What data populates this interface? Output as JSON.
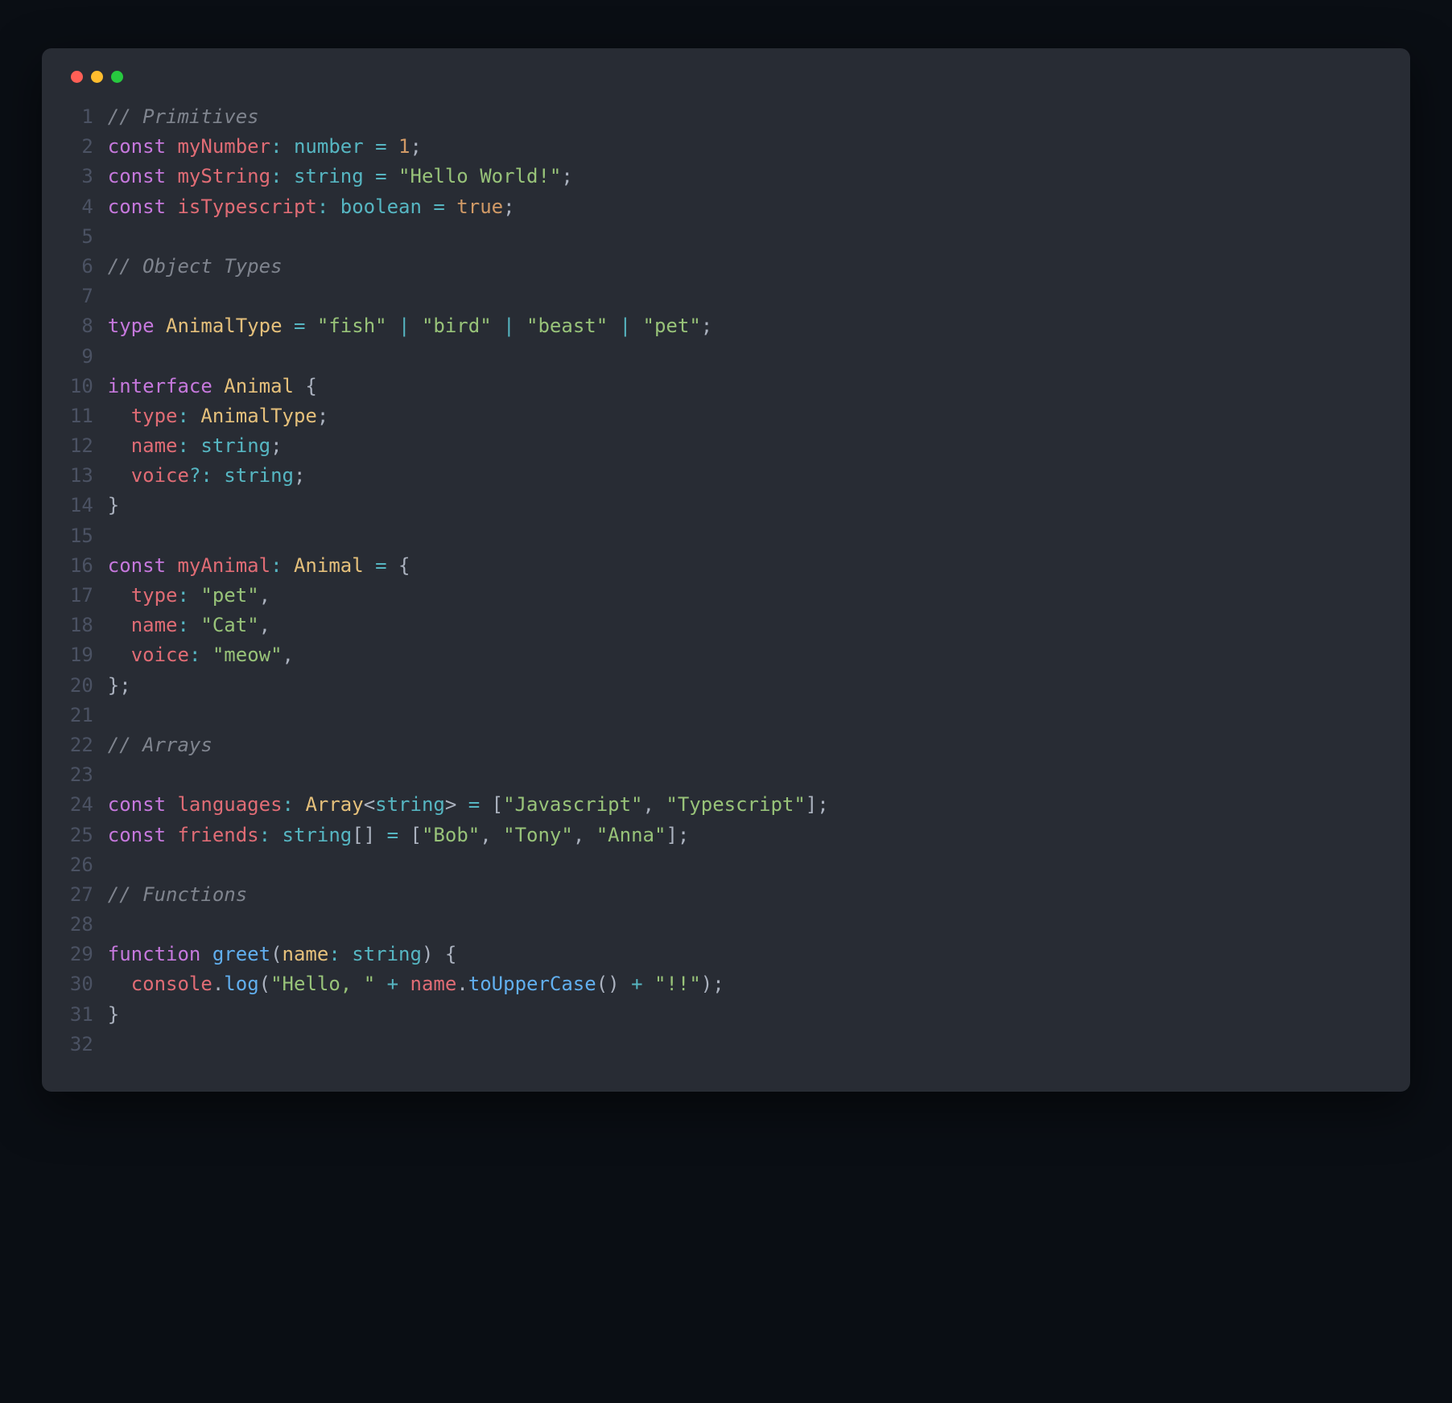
{
  "window": {
    "traffic_lights": [
      "red",
      "yellow",
      "green"
    ]
  },
  "code": {
    "lines": [
      {
        "n": 1,
        "tokens": [
          {
            "cls": "c-comment",
            "t": "// Primitives"
          }
        ]
      },
      {
        "n": 2,
        "tokens": [
          {
            "cls": "c-keyword",
            "t": "const"
          },
          {
            "cls": "c-punct",
            "t": " "
          },
          {
            "cls": "c-var",
            "t": "myNumber"
          },
          {
            "cls": "c-op",
            "t": ":"
          },
          {
            "cls": "c-punct",
            "t": " "
          },
          {
            "cls": "c-builtin",
            "t": "number"
          },
          {
            "cls": "c-punct",
            "t": " "
          },
          {
            "cls": "c-op",
            "t": "="
          },
          {
            "cls": "c-punct",
            "t": " "
          },
          {
            "cls": "c-number",
            "t": "1"
          },
          {
            "cls": "c-punct",
            "t": ";"
          }
        ]
      },
      {
        "n": 3,
        "tokens": [
          {
            "cls": "c-keyword",
            "t": "const"
          },
          {
            "cls": "c-punct",
            "t": " "
          },
          {
            "cls": "c-var",
            "t": "myString"
          },
          {
            "cls": "c-op",
            "t": ":"
          },
          {
            "cls": "c-punct",
            "t": " "
          },
          {
            "cls": "c-builtin",
            "t": "string"
          },
          {
            "cls": "c-punct",
            "t": " "
          },
          {
            "cls": "c-op",
            "t": "="
          },
          {
            "cls": "c-punct",
            "t": " "
          },
          {
            "cls": "c-string",
            "t": "\"Hello World!\""
          },
          {
            "cls": "c-punct",
            "t": ";"
          }
        ]
      },
      {
        "n": 4,
        "tokens": [
          {
            "cls": "c-keyword",
            "t": "const"
          },
          {
            "cls": "c-punct",
            "t": " "
          },
          {
            "cls": "c-var",
            "t": "isTypescript"
          },
          {
            "cls": "c-op",
            "t": ":"
          },
          {
            "cls": "c-punct",
            "t": " "
          },
          {
            "cls": "c-builtin",
            "t": "boolean"
          },
          {
            "cls": "c-punct",
            "t": " "
          },
          {
            "cls": "c-op",
            "t": "="
          },
          {
            "cls": "c-punct",
            "t": " "
          },
          {
            "cls": "c-boolean",
            "t": "true"
          },
          {
            "cls": "c-punct",
            "t": ";"
          }
        ]
      },
      {
        "n": 5,
        "tokens": []
      },
      {
        "n": 6,
        "tokens": [
          {
            "cls": "c-comment",
            "t": "// Object Types"
          }
        ]
      },
      {
        "n": 7,
        "tokens": []
      },
      {
        "n": 8,
        "tokens": [
          {
            "cls": "c-keyword",
            "t": "type"
          },
          {
            "cls": "c-punct",
            "t": " "
          },
          {
            "cls": "c-typeref",
            "t": "AnimalType"
          },
          {
            "cls": "c-punct",
            "t": " "
          },
          {
            "cls": "c-op",
            "t": "="
          },
          {
            "cls": "c-punct",
            "t": " "
          },
          {
            "cls": "c-string",
            "t": "\"fish\""
          },
          {
            "cls": "c-punct",
            "t": " "
          },
          {
            "cls": "c-op",
            "t": "|"
          },
          {
            "cls": "c-punct",
            "t": " "
          },
          {
            "cls": "c-string",
            "t": "\"bird\""
          },
          {
            "cls": "c-punct",
            "t": " "
          },
          {
            "cls": "c-op",
            "t": "|"
          },
          {
            "cls": "c-punct",
            "t": " "
          },
          {
            "cls": "c-string",
            "t": "\"beast\""
          },
          {
            "cls": "c-punct",
            "t": " "
          },
          {
            "cls": "c-op",
            "t": "|"
          },
          {
            "cls": "c-punct",
            "t": " "
          },
          {
            "cls": "c-string",
            "t": "\"pet\""
          },
          {
            "cls": "c-punct",
            "t": ";"
          }
        ]
      },
      {
        "n": 9,
        "tokens": []
      },
      {
        "n": 10,
        "tokens": [
          {
            "cls": "c-keyword",
            "t": "interface"
          },
          {
            "cls": "c-punct",
            "t": " "
          },
          {
            "cls": "c-typeref",
            "t": "Animal"
          },
          {
            "cls": "c-punct",
            "t": " {"
          }
        ]
      },
      {
        "n": 11,
        "tokens": [
          {
            "cls": "c-punct",
            "t": "  "
          },
          {
            "cls": "c-prop",
            "t": "type"
          },
          {
            "cls": "c-op",
            "t": ":"
          },
          {
            "cls": "c-punct",
            "t": " "
          },
          {
            "cls": "c-typeref",
            "t": "AnimalType"
          },
          {
            "cls": "c-punct",
            "t": ";"
          }
        ]
      },
      {
        "n": 12,
        "tokens": [
          {
            "cls": "c-punct",
            "t": "  "
          },
          {
            "cls": "c-prop",
            "t": "name"
          },
          {
            "cls": "c-op",
            "t": ":"
          },
          {
            "cls": "c-punct",
            "t": " "
          },
          {
            "cls": "c-builtin",
            "t": "string"
          },
          {
            "cls": "c-punct",
            "t": ";"
          }
        ]
      },
      {
        "n": 13,
        "tokens": [
          {
            "cls": "c-punct",
            "t": "  "
          },
          {
            "cls": "c-prop",
            "t": "voice"
          },
          {
            "cls": "c-op",
            "t": "?:"
          },
          {
            "cls": "c-punct",
            "t": " "
          },
          {
            "cls": "c-builtin",
            "t": "string"
          },
          {
            "cls": "c-punct",
            "t": ";"
          }
        ]
      },
      {
        "n": 14,
        "tokens": [
          {
            "cls": "c-punct",
            "t": "}"
          }
        ]
      },
      {
        "n": 15,
        "tokens": []
      },
      {
        "n": 16,
        "tokens": [
          {
            "cls": "c-keyword",
            "t": "const"
          },
          {
            "cls": "c-punct",
            "t": " "
          },
          {
            "cls": "c-var",
            "t": "myAnimal"
          },
          {
            "cls": "c-op",
            "t": ":"
          },
          {
            "cls": "c-punct",
            "t": " "
          },
          {
            "cls": "c-typeref",
            "t": "Animal"
          },
          {
            "cls": "c-punct",
            "t": " "
          },
          {
            "cls": "c-op",
            "t": "="
          },
          {
            "cls": "c-punct",
            "t": " {"
          }
        ]
      },
      {
        "n": 17,
        "tokens": [
          {
            "cls": "c-punct",
            "t": "  "
          },
          {
            "cls": "c-prop",
            "t": "type"
          },
          {
            "cls": "c-op",
            "t": ":"
          },
          {
            "cls": "c-punct",
            "t": " "
          },
          {
            "cls": "c-string",
            "t": "\"pet\""
          },
          {
            "cls": "c-punct",
            "t": ","
          }
        ]
      },
      {
        "n": 18,
        "tokens": [
          {
            "cls": "c-punct",
            "t": "  "
          },
          {
            "cls": "c-prop",
            "t": "name"
          },
          {
            "cls": "c-op",
            "t": ":"
          },
          {
            "cls": "c-punct",
            "t": " "
          },
          {
            "cls": "c-string",
            "t": "\"Cat\""
          },
          {
            "cls": "c-punct",
            "t": ","
          }
        ]
      },
      {
        "n": 19,
        "tokens": [
          {
            "cls": "c-punct",
            "t": "  "
          },
          {
            "cls": "c-prop",
            "t": "voice"
          },
          {
            "cls": "c-op",
            "t": ":"
          },
          {
            "cls": "c-punct",
            "t": " "
          },
          {
            "cls": "c-string",
            "t": "\"meow\""
          },
          {
            "cls": "c-punct",
            "t": ","
          }
        ]
      },
      {
        "n": 20,
        "tokens": [
          {
            "cls": "c-punct",
            "t": "};"
          }
        ]
      },
      {
        "n": 21,
        "tokens": []
      },
      {
        "n": 22,
        "tokens": [
          {
            "cls": "c-comment",
            "t": "// Arrays"
          }
        ]
      },
      {
        "n": 23,
        "tokens": []
      },
      {
        "n": 24,
        "tokens": [
          {
            "cls": "c-keyword",
            "t": "const"
          },
          {
            "cls": "c-punct",
            "t": " "
          },
          {
            "cls": "c-var",
            "t": "languages"
          },
          {
            "cls": "c-op",
            "t": ":"
          },
          {
            "cls": "c-punct",
            "t": " "
          },
          {
            "cls": "c-typeref",
            "t": "Array"
          },
          {
            "cls": "c-punct",
            "t": "<"
          },
          {
            "cls": "c-builtin",
            "t": "string"
          },
          {
            "cls": "c-punct",
            "t": "> "
          },
          {
            "cls": "c-op",
            "t": "="
          },
          {
            "cls": "c-punct",
            "t": " ["
          },
          {
            "cls": "c-string",
            "t": "\"Javascript\""
          },
          {
            "cls": "c-punct",
            "t": ", "
          },
          {
            "cls": "c-string",
            "t": "\"Typescript\""
          },
          {
            "cls": "c-punct",
            "t": "];"
          }
        ]
      },
      {
        "n": 25,
        "tokens": [
          {
            "cls": "c-keyword",
            "t": "const"
          },
          {
            "cls": "c-punct",
            "t": " "
          },
          {
            "cls": "c-var",
            "t": "friends"
          },
          {
            "cls": "c-op",
            "t": ":"
          },
          {
            "cls": "c-punct",
            "t": " "
          },
          {
            "cls": "c-builtin",
            "t": "string"
          },
          {
            "cls": "c-punct",
            "t": "[] "
          },
          {
            "cls": "c-op",
            "t": "="
          },
          {
            "cls": "c-punct",
            "t": " ["
          },
          {
            "cls": "c-string",
            "t": "\"Bob\""
          },
          {
            "cls": "c-punct",
            "t": ", "
          },
          {
            "cls": "c-string",
            "t": "\"Tony\""
          },
          {
            "cls": "c-punct",
            "t": ", "
          },
          {
            "cls": "c-string",
            "t": "\"Anna\""
          },
          {
            "cls": "c-punct",
            "t": "];"
          }
        ]
      },
      {
        "n": 26,
        "tokens": []
      },
      {
        "n": 27,
        "tokens": [
          {
            "cls": "c-comment",
            "t": "// Functions"
          }
        ]
      },
      {
        "n": 28,
        "tokens": []
      },
      {
        "n": 29,
        "tokens": [
          {
            "cls": "c-keyword",
            "t": "function"
          },
          {
            "cls": "c-punct",
            "t": " "
          },
          {
            "cls": "c-method",
            "t": "greet"
          },
          {
            "cls": "c-punct",
            "t": "("
          },
          {
            "cls": "c-param",
            "t": "name"
          },
          {
            "cls": "c-op",
            "t": ":"
          },
          {
            "cls": "c-punct",
            "t": " "
          },
          {
            "cls": "c-builtin",
            "t": "string"
          },
          {
            "cls": "c-punct",
            "t": ") {"
          }
        ]
      },
      {
        "n": 30,
        "tokens": [
          {
            "cls": "c-punct",
            "t": "  "
          },
          {
            "cls": "c-var",
            "t": "console"
          },
          {
            "cls": "c-punct",
            "t": "."
          },
          {
            "cls": "c-method",
            "t": "log"
          },
          {
            "cls": "c-punct",
            "t": "("
          },
          {
            "cls": "c-string",
            "t": "\"Hello, \""
          },
          {
            "cls": "c-punct",
            "t": " "
          },
          {
            "cls": "c-op",
            "t": "+"
          },
          {
            "cls": "c-punct",
            "t": " "
          },
          {
            "cls": "c-var",
            "t": "name"
          },
          {
            "cls": "c-punct",
            "t": "."
          },
          {
            "cls": "c-method",
            "t": "toUpperCase"
          },
          {
            "cls": "c-punct",
            "t": "() "
          },
          {
            "cls": "c-op",
            "t": "+"
          },
          {
            "cls": "c-punct",
            "t": " "
          },
          {
            "cls": "c-string",
            "t": "\"!!\""
          },
          {
            "cls": "c-punct",
            "t": ");"
          }
        ]
      },
      {
        "n": 31,
        "tokens": [
          {
            "cls": "c-punct",
            "t": "}"
          }
        ]
      },
      {
        "n": 32,
        "tokens": []
      }
    ]
  }
}
